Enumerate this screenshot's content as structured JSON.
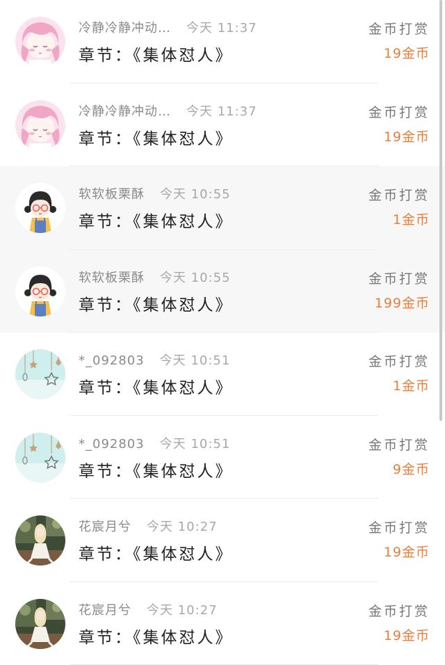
{
  "colors": {
    "amount": "#e8803a",
    "name": "#8a8a8a",
    "chapter": "#222222",
    "reward_label": "#777777"
  },
  "rows": [
    {
      "name": "冷静冷静冲动…",
      "time": "今天 11:37",
      "chapter": "章节：《集体怼人》",
      "reward_label": "金币打赏",
      "amount": "19金币",
      "avatar": "pink-anime-girl-avatar"
    },
    {
      "name": "冷静冷静冲动…",
      "time": "今天 11:37",
      "chapter": "章节：《集体怼人》",
      "reward_label": "金币打赏",
      "amount": "19金币",
      "avatar": "pink-anime-girl-avatar"
    },
    {
      "name": "软软板栗酥",
      "time": "今天 10:55",
      "chapter": "章节：《集体怼人》",
      "reward_label": "金币打赏",
      "amount": "1金币",
      "avatar": "cartoon-girl-glasses-avatar"
    },
    {
      "name": "软软板栗酥",
      "time": "今天 10:55",
      "chapter": "章节：《集体怼人》",
      "reward_label": "金币打赏",
      "amount": "199金币",
      "avatar": "cartoon-girl-glasses-avatar"
    },
    {
      "name": "*_092803",
      "time": "今天 10:51",
      "chapter": "章节：《集体怼人》",
      "reward_label": "金币打赏",
      "amount": "1金币",
      "avatar": "hanging-stars-avatar"
    },
    {
      "name": "*_092803",
      "time": "今天 10:51",
      "chapter": "章节：《集体怼人》",
      "reward_label": "金币打赏",
      "amount": "9金币",
      "avatar": "hanging-stars-avatar"
    },
    {
      "name": "花宸月兮",
      "time": "今天 10:27",
      "chapter": "章节：《集体怼人》",
      "reward_label": "金币打赏",
      "amount": "19金币",
      "avatar": "doll-in-garden-avatar"
    },
    {
      "name": "花宸月兮",
      "time": "今天 10:27",
      "chapter": "章节：《集体怼人》",
      "reward_label": "金币打赏",
      "amount": "19金币",
      "avatar": "doll-in-garden-avatar"
    }
  ]
}
